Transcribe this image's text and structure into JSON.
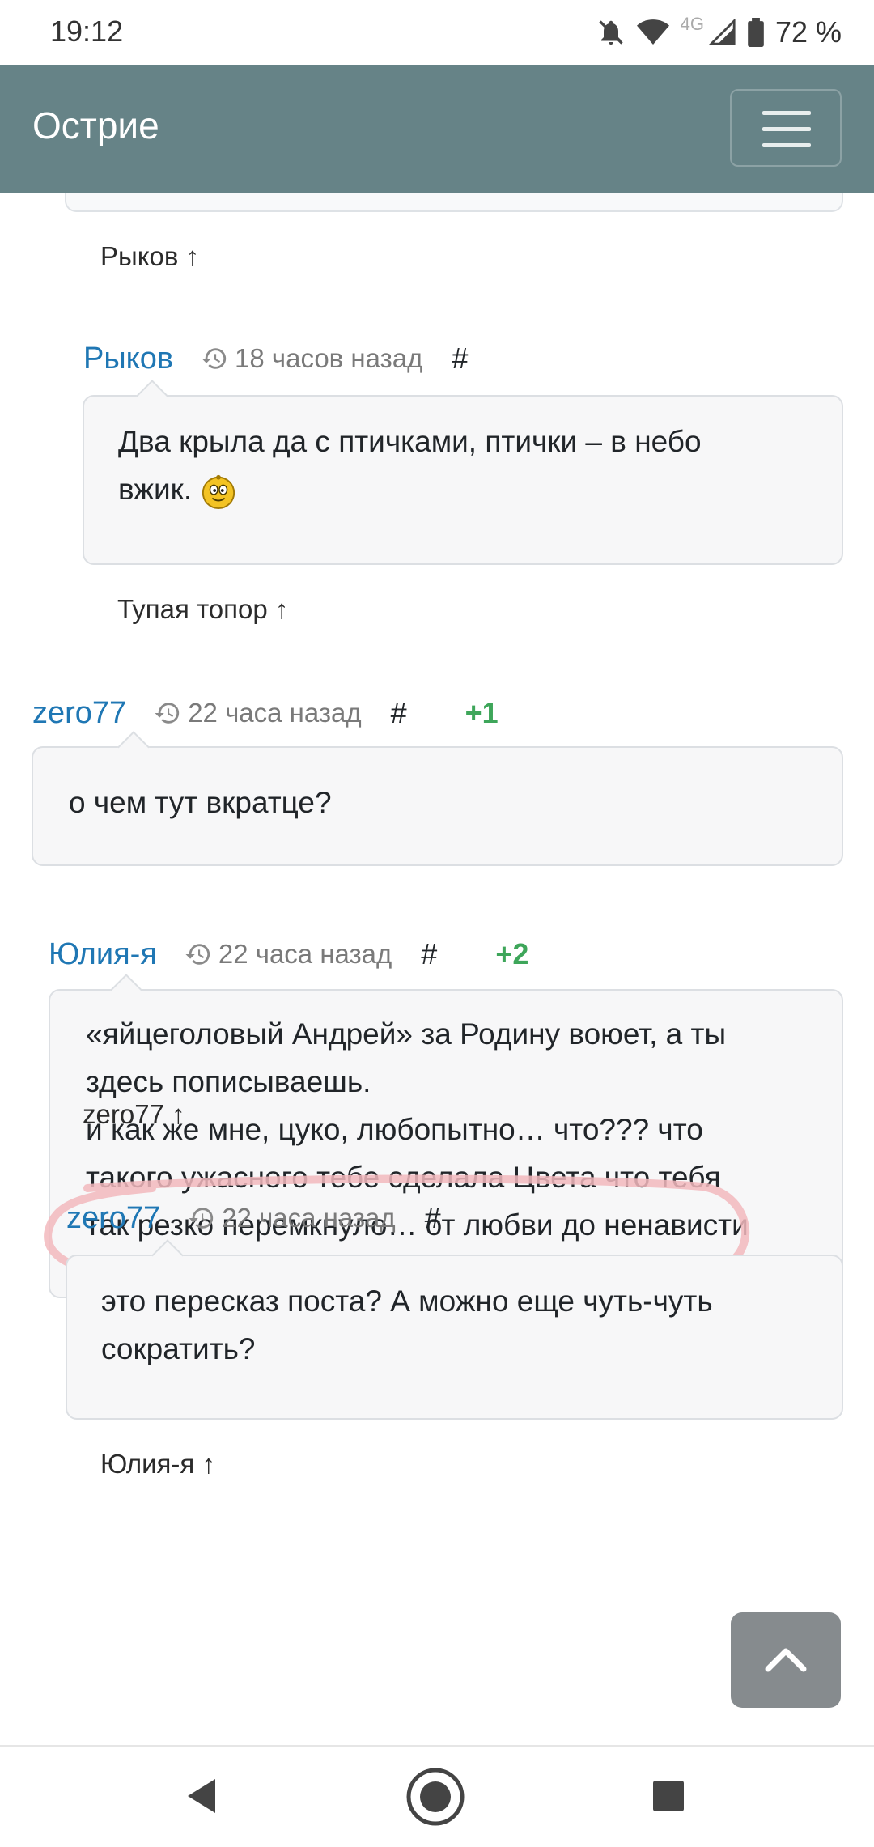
{
  "status_bar": {
    "time": "19:12",
    "network": "4G",
    "battery": "72 %"
  },
  "navbar": {
    "brand": "Острие"
  },
  "comments": [
    {
      "reply_to": "Рыков ↑"
    },
    {
      "author": "Рыков",
      "time": "18 часов назад",
      "anchor": "#",
      "text_line1": "Два крыла да с птичками, птички – в небо",
      "text_line2": "вжик.",
      "reply_to": "Тупая топор ↑"
    },
    {
      "author": "zero77",
      "time": "22 часа назад",
      "anchor": "#",
      "score": "+1",
      "text": "о чем тут вкратце?"
    },
    {
      "author": "Юлия-я",
      "time": "22 часа назад",
      "anchor": "#",
      "score": "+2",
      "lines": [
        "«яйцеголовый Андрей» за Родину воюет, а ты",
        "здесь пописываешь.",
        "и как же мне, цуко, любопытно… что??? что",
        "такого ужасного тебе сделала Цвета что тебя",
        "так резко перемкнуло… от любви до ненависти"
      ],
      "reply_to": "zero77 ↑"
    },
    {
      "author": "zero77",
      "time": "22 часа назад",
      "anchor": "#",
      "text_line1": "это пересказ поста? А можно еще чуть-чуть",
      "text_line2": "сократить?",
      "reply_to": "Юлия-я ↑"
    }
  ],
  "colors": {
    "navbar": "#668387",
    "author": "#1f77b4",
    "score": "#3ea65a",
    "highlight": "#f2b8bd"
  }
}
